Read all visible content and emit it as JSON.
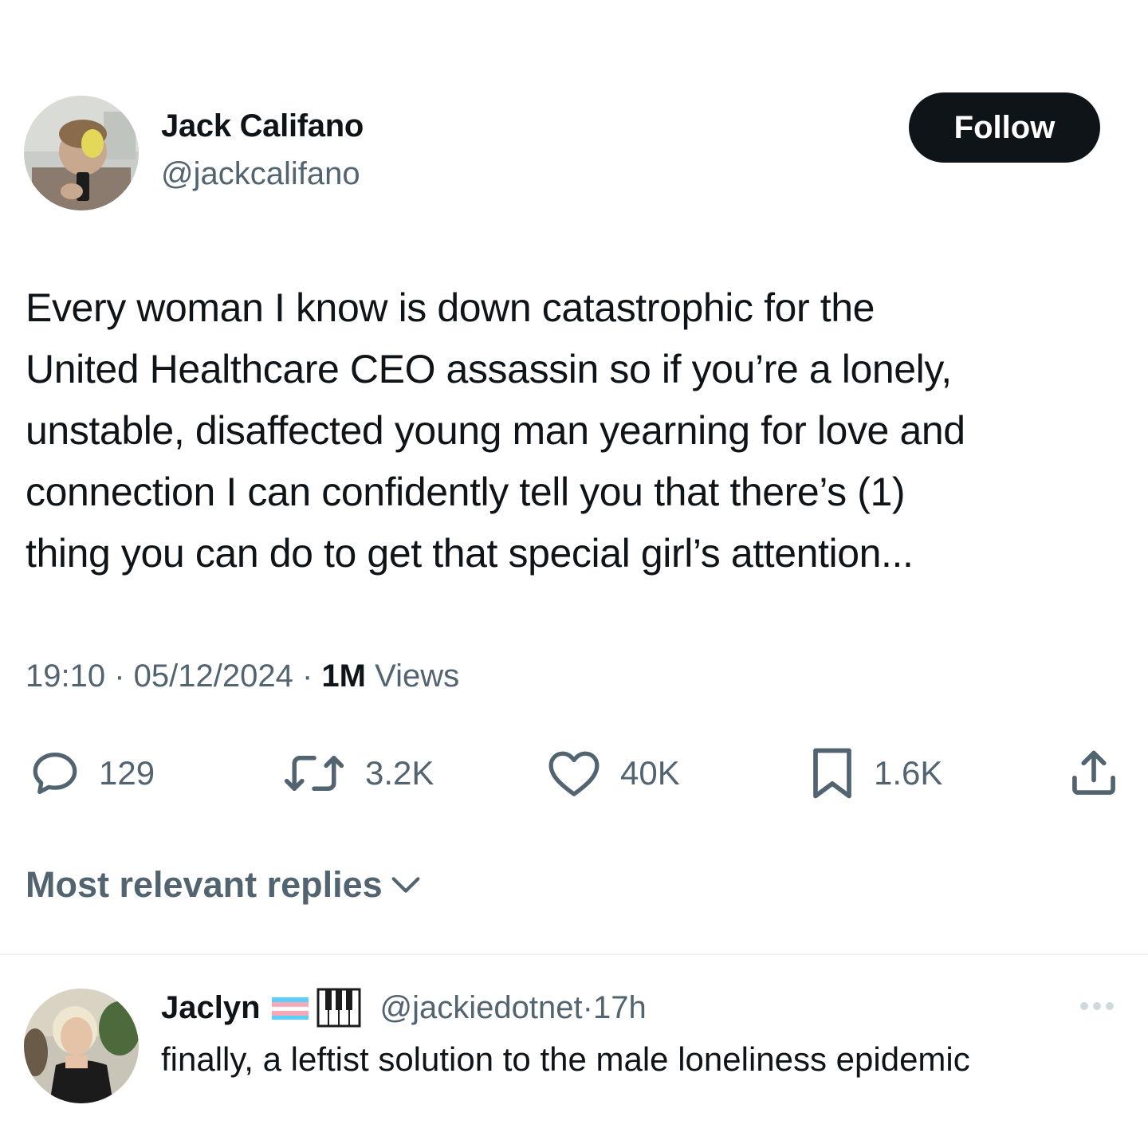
{
  "tweet": {
    "author_name": "Jack Califano",
    "author_handle": "@jackcalifano",
    "follow_label": "Follow",
    "text": "Every woman I know is down catastrophic for the\nUnited Healthcare CEO assassin so if you’re a lonely,\nunstable, disaffected young man yearning for love and\nconnection I can confidently tell you that there’s (1)\nthing you can do to get that special girl’s attention...",
    "time": "19:10",
    "date": "05/12/2024",
    "views_count": "1M",
    "views_label": "Views",
    "separator": " · "
  },
  "actions": {
    "replies": "129",
    "reposts": "3.2K",
    "likes": "40K",
    "bookmarks": "1.6K"
  },
  "replies_section": {
    "label": "Most relevant replies"
  },
  "reply": {
    "name": "Jaclyn",
    "handle": "@jackiedotnet",
    "time": "17h",
    "separator": " · ",
    "text": "finally, a leftist solution to the male loneliness epidemic"
  },
  "colors": {
    "text_primary": "#0f1419",
    "text_secondary": "#536471",
    "follow_bg": "#0f1419",
    "divider": "#eff3f4",
    "flag_blue": "#5bcefa",
    "flag_pink": "#f5a9b8"
  },
  "icons": {
    "reply": "speech-bubble-icon",
    "repost": "repost-arrows-icon",
    "like": "heart-icon",
    "bookmark": "bookmark-icon",
    "share": "share-upload-icon",
    "chevron": "chevron-down-icon",
    "more": "more-dots-icon",
    "flag": "transgender-flag-emoji",
    "piano": "piano-keys-emoji"
  }
}
